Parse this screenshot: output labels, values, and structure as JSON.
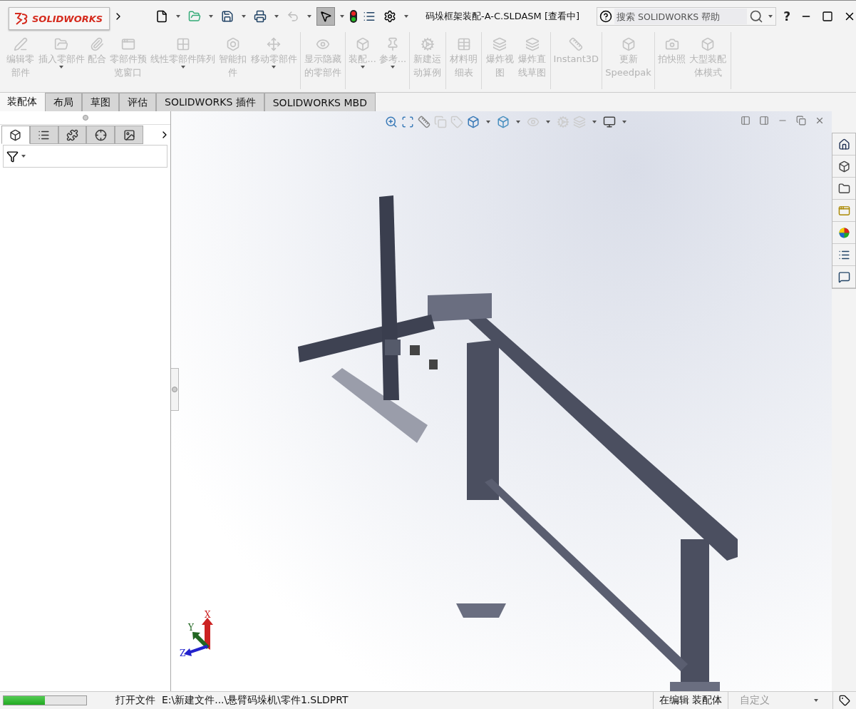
{
  "app": {
    "logo": "SOLIDWORKS",
    "title": "码垛框架装配-A-C.SLDASM [查看中]",
    "search_placeholder": "搜索 SOLIDWORKS 帮助",
    "help": "?"
  },
  "ribbon_groups": [
    {
      "commands": [
        {
          "label": "编辑零部件",
          "dropdown": false,
          "disabled": true
        },
        {
          "label": "插入零部件",
          "dropdown": true,
          "disabled": true
        },
        {
          "label": "配合",
          "dropdown": false,
          "disabled": true
        },
        {
          "label": "零部件预览窗口",
          "dropdown": false,
          "disabled": true
        },
        {
          "label": "线性零部件阵列",
          "dropdown": true,
          "disabled": true
        },
        {
          "label": "智能扣件",
          "dropdown": false,
          "disabled": true
        },
        {
          "label": "移动零部件",
          "dropdown": true,
          "disabled": true
        }
      ]
    },
    {
      "commands": [
        {
          "label": "显示隐藏的零部件",
          "dropdown": false,
          "disabled": true
        }
      ]
    },
    {
      "commands": [
        {
          "label": "装配...",
          "dropdown": true,
          "disabled": true
        },
        {
          "label": "参考...",
          "dropdown": true,
          "disabled": true
        }
      ]
    },
    {
      "commands": [
        {
          "label": "新建运动算例",
          "dropdown": false,
          "disabled": true
        }
      ]
    },
    {
      "commands": [
        {
          "label": "材料明细表",
          "dropdown": false,
          "disabled": true
        }
      ]
    },
    {
      "commands": [
        {
          "label": "爆炸视图",
          "dropdown": false,
          "disabled": true
        },
        {
          "label": "爆炸直线草图",
          "dropdown": false,
          "disabled": true
        }
      ]
    },
    {
      "commands": [
        {
          "label": "Instant3D",
          "dropdown": false,
          "disabled": true
        }
      ]
    },
    {
      "commands": [
        {
          "label": "更新Speedpak",
          "dropdown": false,
          "disabled": true
        }
      ]
    },
    {
      "commands": [
        {
          "label": "拍快照",
          "dropdown": false,
          "disabled": true
        },
        {
          "label": "大型装配体模式",
          "dropdown": false,
          "disabled": true
        }
      ]
    }
  ],
  "tabs": [
    {
      "label": "装配体",
      "selected": true
    },
    {
      "label": "布局",
      "selected": false
    },
    {
      "label": "草图",
      "selected": false
    },
    {
      "label": "评估",
      "selected": false
    },
    {
      "label": "SOLIDWORKS 插件",
      "selected": false
    },
    {
      "label": "SOLIDWORKS MBD",
      "selected": false
    }
  ],
  "panel_tabs": [
    {
      "selected": true
    },
    {
      "selected": false
    },
    {
      "selected": false
    },
    {
      "selected": false
    },
    {
      "selected": false
    }
  ],
  "triad": {
    "x": "X",
    "y": "Y",
    "z": "Z"
  },
  "status_bar": {
    "progress": {
      "level": 0.5
    },
    "message": "打开文件  E:\\新建文件...\\悬臂码垛机\\零件1.SLDPRT",
    "mode": "在编辑 装配体",
    "units": "自定义"
  }
}
